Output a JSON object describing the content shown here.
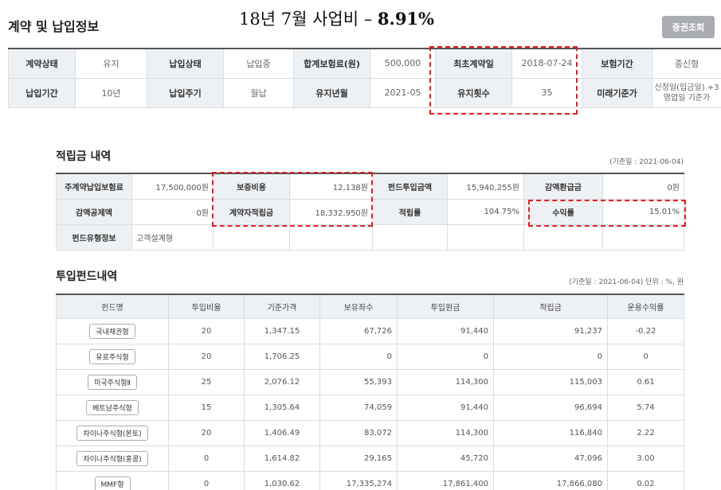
{
  "header": {
    "title": "계약 및 납입정보",
    "overlay_note_prefix": "18년 7월 사업비 – ",
    "overlay_note_value": "8.91%",
    "certificate_button": "증권조회"
  },
  "contract": {
    "rows": [
      [
        {
          "label": "계약상태",
          "value": "유지"
        },
        {
          "label": "납입상태",
          "value": "납입중"
        },
        {
          "label": "합계보험료(원)",
          "value": "500,000"
        },
        {
          "label": "최초계약일",
          "value": "2018-07-24"
        },
        {
          "label": "보험기간",
          "value": "종신형"
        }
      ],
      [
        {
          "label": "납입기간",
          "value": "10년"
        },
        {
          "label": "납입주기",
          "value": "월납"
        },
        {
          "label": "유지년월",
          "value": "2021-05"
        },
        {
          "label": "유지횟수",
          "value": "35"
        },
        {
          "label": "미래기준가",
          "value": "신청일(입금일) +3영업일 기준가"
        }
      ]
    ]
  },
  "savings": {
    "title": "적립금 내역",
    "base_date": "(기준일 : 2021-06-04)",
    "rows": [
      [
        {
          "label": "주계약납입보험료",
          "value": "17,500,000원"
        },
        {
          "label": "보증비용",
          "value": "12,138원"
        },
        {
          "label": "펀드투입금액",
          "value": "15,940,255원"
        },
        {
          "label": "감액환급금",
          "value": "0원"
        }
      ],
      [
        {
          "label": "감액공제액",
          "value": "0원"
        },
        {
          "label": "계약자적립금",
          "value": "18,332,950원"
        },
        {
          "label": "적립률",
          "value": "104.75%"
        },
        {
          "label": "수익률",
          "value": "15.01%"
        }
      ],
      [
        {
          "label": "펀드유형정보",
          "value": "고객설계형"
        }
      ]
    ]
  },
  "funds": {
    "title": "투입펀드내역",
    "base_date": "(기준일 : 2021-06-04) 단위 : %, 원",
    "columns": [
      "펀드명",
      "투입비율",
      "기준가격",
      "보유좌수",
      "투입원금",
      "적립금",
      "운용수익률"
    ],
    "rows": [
      [
        "국내채권형",
        "20",
        "1,347.15",
        "67,726",
        "91,440",
        "91,237",
        "-0.22"
      ],
      [
        "유로주식형",
        "20",
        "1,706.25",
        "0",
        "0",
        "0",
        "0"
      ],
      [
        "미국주식형Ⅱ",
        "25",
        "2,076.12",
        "55,393",
        "114,300",
        "115,003",
        "0.61"
      ],
      [
        "베트남주식형",
        "15",
        "1,305.64",
        "74,059",
        "91,440",
        "96,694",
        "5.74"
      ],
      [
        "차이나주식형(본토)",
        "20",
        "1,406.49",
        "83,072",
        "114,300",
        "116,840",
        "2.22"
      ],
      [
        "차이나주식형(홍콩)",
        "0",
        "1,614.82",
        "29,165",
        "45,720",
        "47,096",
        "3.00"
      ],
      [
        "MMF형",
        "0",
        "1,030.62",
        "17,335,274",
        "17,861,400",
        "17,866,080",
        "0.02"
      ]
    ]
  },
  "colors": {
    "highlight": "#e0201f",
    "label_bg": "#eef1f4",
    "button_bg": "#a9acb1"
  }
}
